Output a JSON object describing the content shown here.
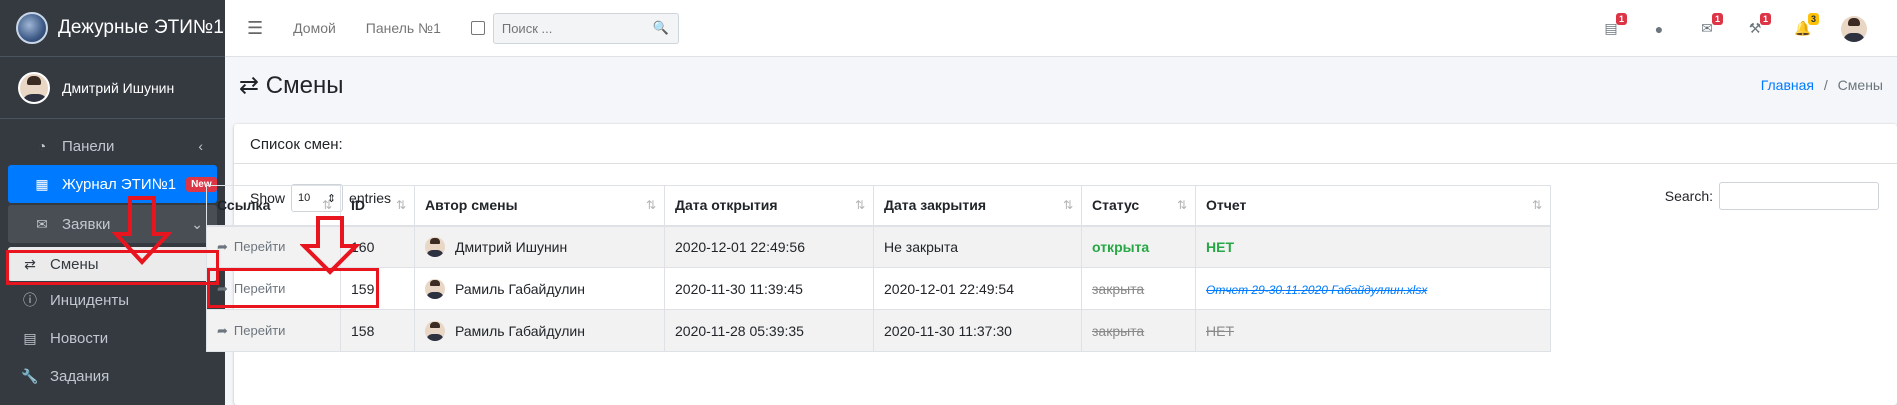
{
  "brand": {
    "title": "Дежурные ЭТИ№1"
  },
  "user": {
    "name": "Дмитрий Ишунин"
  },
  "sidebar": {
    "items": [
      {
        "label": "Панели",
        "icon": "tachometer-icon"
      },
      {
        "label": "Журнал ЭТИ№1",
        "icon": "grid-icon",
        "badge": "New"
      },
      {
        "label": "Заявки",
        "icon": "envelope-icon"
      },
      {
        "label": "Смены",
        "icon": "exchange-icon"
      },
      {
        "label": "Инциденты",
        "icon": "info-icon"
      },
      {
        "label": "Новости",
        "icon": "newspaper-icon"
      },
      {
        "label": "Задания",
        "icon": "wrench-icon"
      }
    ]
  },
  "topbar": {
    "home": "Домой",
    "panel": "Панель №1",
    "search_placeholder": "Поиск ...",
    "badges": {
      "inbox": "1",
      "mail": "1",
      "tools": "1",
      "bell": "3"
    }
  },
  "header": {
    "title": "Смены",
    "breadcrumb_home": "Главная",
    "breadcrumb_sep": "/",
    "breadcrumb_current": "Смены"
  },
  "card": {
    "title": "Список смен:",
    "show": "Show",
    "entries_value": "10",
    "entries": "entries",
    "search": "Search:"
  },
  "table": {
    "columns": [
      "Ссылка",
      "ID",
      "Автор смены",
      "Дата открытия",
      "Дата закрытия",
      "Статус",
      "Отчет"
    ],
    "rows": [
      {
        "link": "Перейти",
        "id": "160",
        "author": "Дмитрий Ишунин",
        "opened": "2020-12-01 22:49:56",
        "closed": "Не закрыта",
        "status": "открыта",
        "report": "НЕТ"
      },
      {
        "link": "Перейти",
        "id": "159",
        "author": "Рамиль Габайдулин",
        "opened": "2020-11-30 11:39:45",
        "closed": "2020-12-01 22:49:54",
        "status": "закрыта",
        "report": "Отчет 29-30.11.2020 Габайдуллин.xlsx"
      },
      {
        "link": "Перейти",
        "id": "158",
        "author": "Рамиль Габайдулин",
        "opened": "2020-11-28 05:39:35",
        "closed": "2020-11-30 11:37:30",
        "status": "закрыта",
        "report": "НЕТ"
      }
    ]
  },
  "colors": {
    "annotation": "#e8141e",
    "accent": "#007bff",
    "sidebar_bg": "#343a40"
  }
}
